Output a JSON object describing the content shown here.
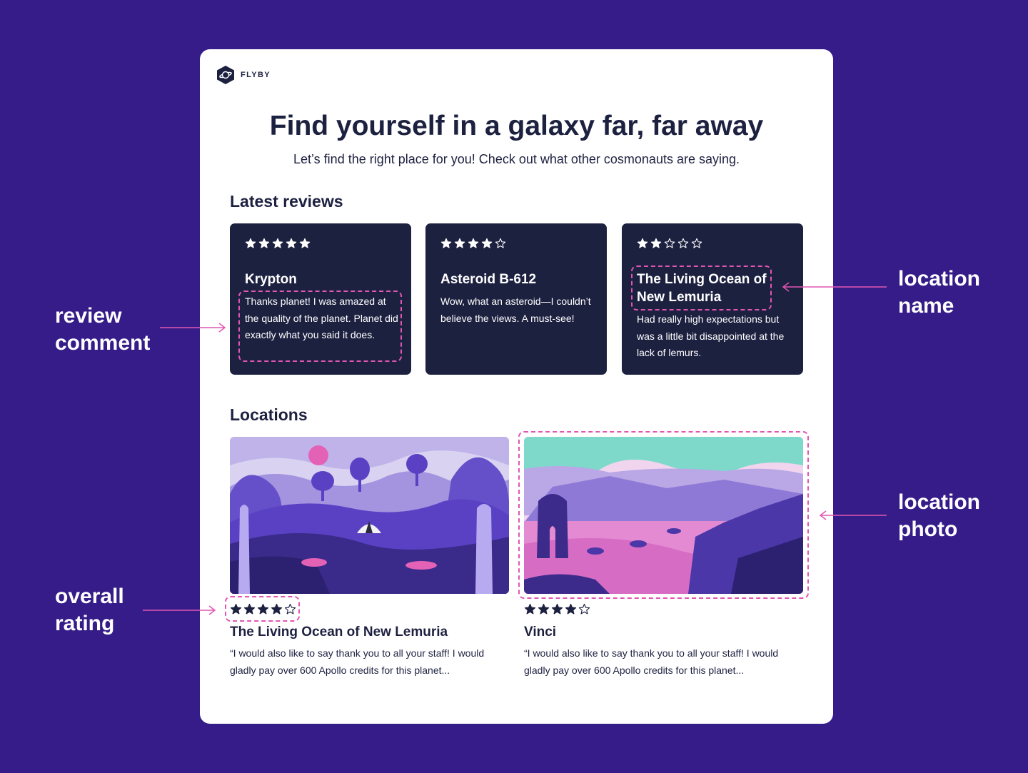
{
  "brand": {
    "name": "FLYBY",
    "logo_icon": "planet-hexagon-icon"
  },
  "hero": {
    "title": "Find yourself in a galaxy far, far away",
    "subtitle": "Let’s find the right place for you! Check out what other cosmonauts are saying."
  },
  "reviews": {
    "title": "Latest reviews",
    "items": [
      {
        "rating": 5,
        "name": "Krypton",
        "comment": "Thanks planet! I was amazed at the quality of the planet. Planet did exactly what you said it does."
      },
      {
        "rating": 4,
        "name": "Asteroid B-612",
        "comment": "Wow, what an asteroid—I couldn’t believe the views. A must-see!"
      },
      {
        "rating": 2,
        "name": "The Living Ocean of New Lemuria",
        "comment": "Had really high expectations but was a little bit disappointed at the lack of lemurs."
      }
    ]
  },
  "locations": {
    "title": "Locations",
    "items": [
      {
        "rating": 4,
        "name": "The Living Ocean of New Lemuria",
        "quote": "“I would also like to say thank you to all your staff! I would gladly pay over 600 Apollo credits for this planet..."
      },
      {
        "rating": 4,
        "name": "Vinci",
        "quote": "“I would also like to say thank you to all your staff! I would gladly pay over 600 Apollo credits for this planet..."
      }
    ]
  },
  "annotations": {
    "review_comment": "review comment",
    "location_name": "location name",
    "location_photo": "location photo",
    "overall_rating": "overall rating"
  },
  "colors": {
    "background": "#351c89",
    "card": "#ffffff",
    "dark": "#1d2140",
    "annotation": "#e156b3",
    "star": "#ffffff"
  }
}
